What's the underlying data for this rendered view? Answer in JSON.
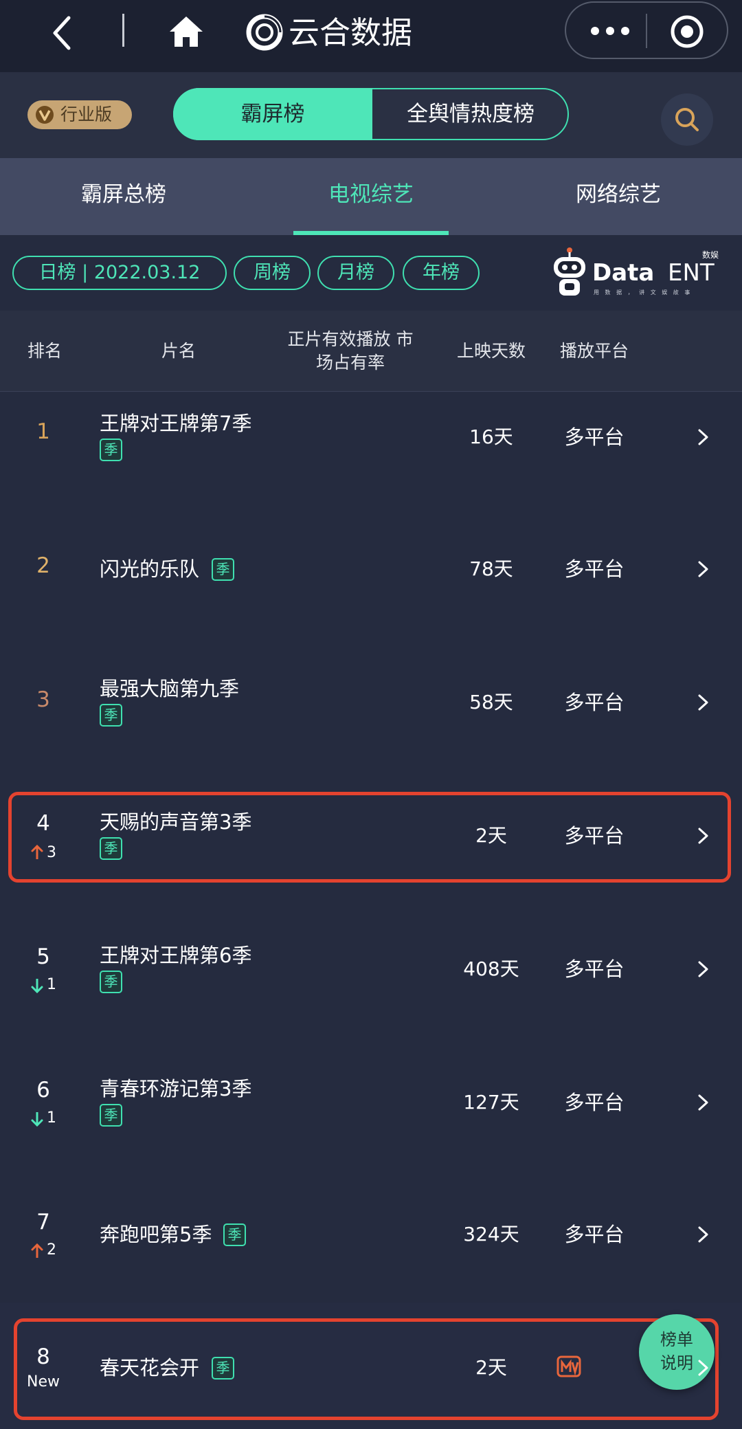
{
  "topbar": {
    "title": "云合数据",
    "icons": [
      "back-icon",
      "home-icon",
      "yunhe-logo-icon",
      "more-icon",
      "target-icon"
    ]
  },
  "header": {
    "badge": "行业版",
    "segments": [
      "霸屏榜",
      "全舆情热度榜"
    ],
    "active_segment": "霸屏榜"
  },
  "tabs": [
    "霸屏总榜",
    "电视综艺",
    "网络综艺"
  ],
  "active_tab": "电视综艺",
  "filters": {
    "date": "日榜 | 2022.03.12",
    "week": "周榜",
    "month": "月榜",
    "year": "年榜"
  },
  "brand": {
    "data": "Data",
    "ent": "ENT",
    "cn": "数娱",
    "slogan": "用 数 据 ， 讲 文 娱 故 事"
  },
  "columns": {
    "rank": "排名",
    "name": "片名",
    "share": "正片有效播放 市场占有率",
    "days": "上映天数",
    "platform": "播放平台"
  },
  "rows": [
    {
      "rank": "1",
      "change": "",
      "name": "王牌对王牌第7季",
      "tag": "季",
      "days": "16天",
      "platform": "多平台"
    },
    {
      "rank": "2",
      "change": "",
      "name": "闪光的乐队",
      "tag": "季",
      "days": "78天",
      "platform": "多平台"
    },
    {
      "rank": "3",
      "change": "",
      "name": "最强大脑第九季",
      "tag": "季",
      "days": "58天",
      "platform": "多平台"
    },
    {
      "rank": "4",
      "change": "3",
      "name": "天赐的声音第3季",
      "tag": "季",
      "days": "2天",
      "platform": "多平台"
    },
    {
      "rank": "5",
      "change": "1",
      "name": "王牌对王牌第6季",
      "tag": "季",
      "days": "408天",
      "platform": "多平台"
    },
    {
      "rank": "6",
      "change": "1",
      "name": "青春环游记第3季",
      "tag": "季",
      "days": "127天",
      "platform": "多平台"
    },
    {
      "rank": "7",
      "change": "2",
      "name": "奔跑吧第5季",
      "tag": "季",
      "days": "324天",
      "platform": "多平台"
    },
    {
      "rank": "8",
      "change": "New",
      "name": "春天花会开",
      "tag": "季",
      "days": "2天",
      "platform": "mango-tv-icon"
    }
  ],
  "float_button": {
    "line1": "榜单",
    "line2": "说明"
  },
  "colors": {
    "accent": "#4ee6b8",
    "gold": "#d9a45a",
    "up": "#e8663c",
    "down": "#4ee6b8",
    "highlight_border": "#e4432f",
    "mango": "#e8663c"
  }
}
